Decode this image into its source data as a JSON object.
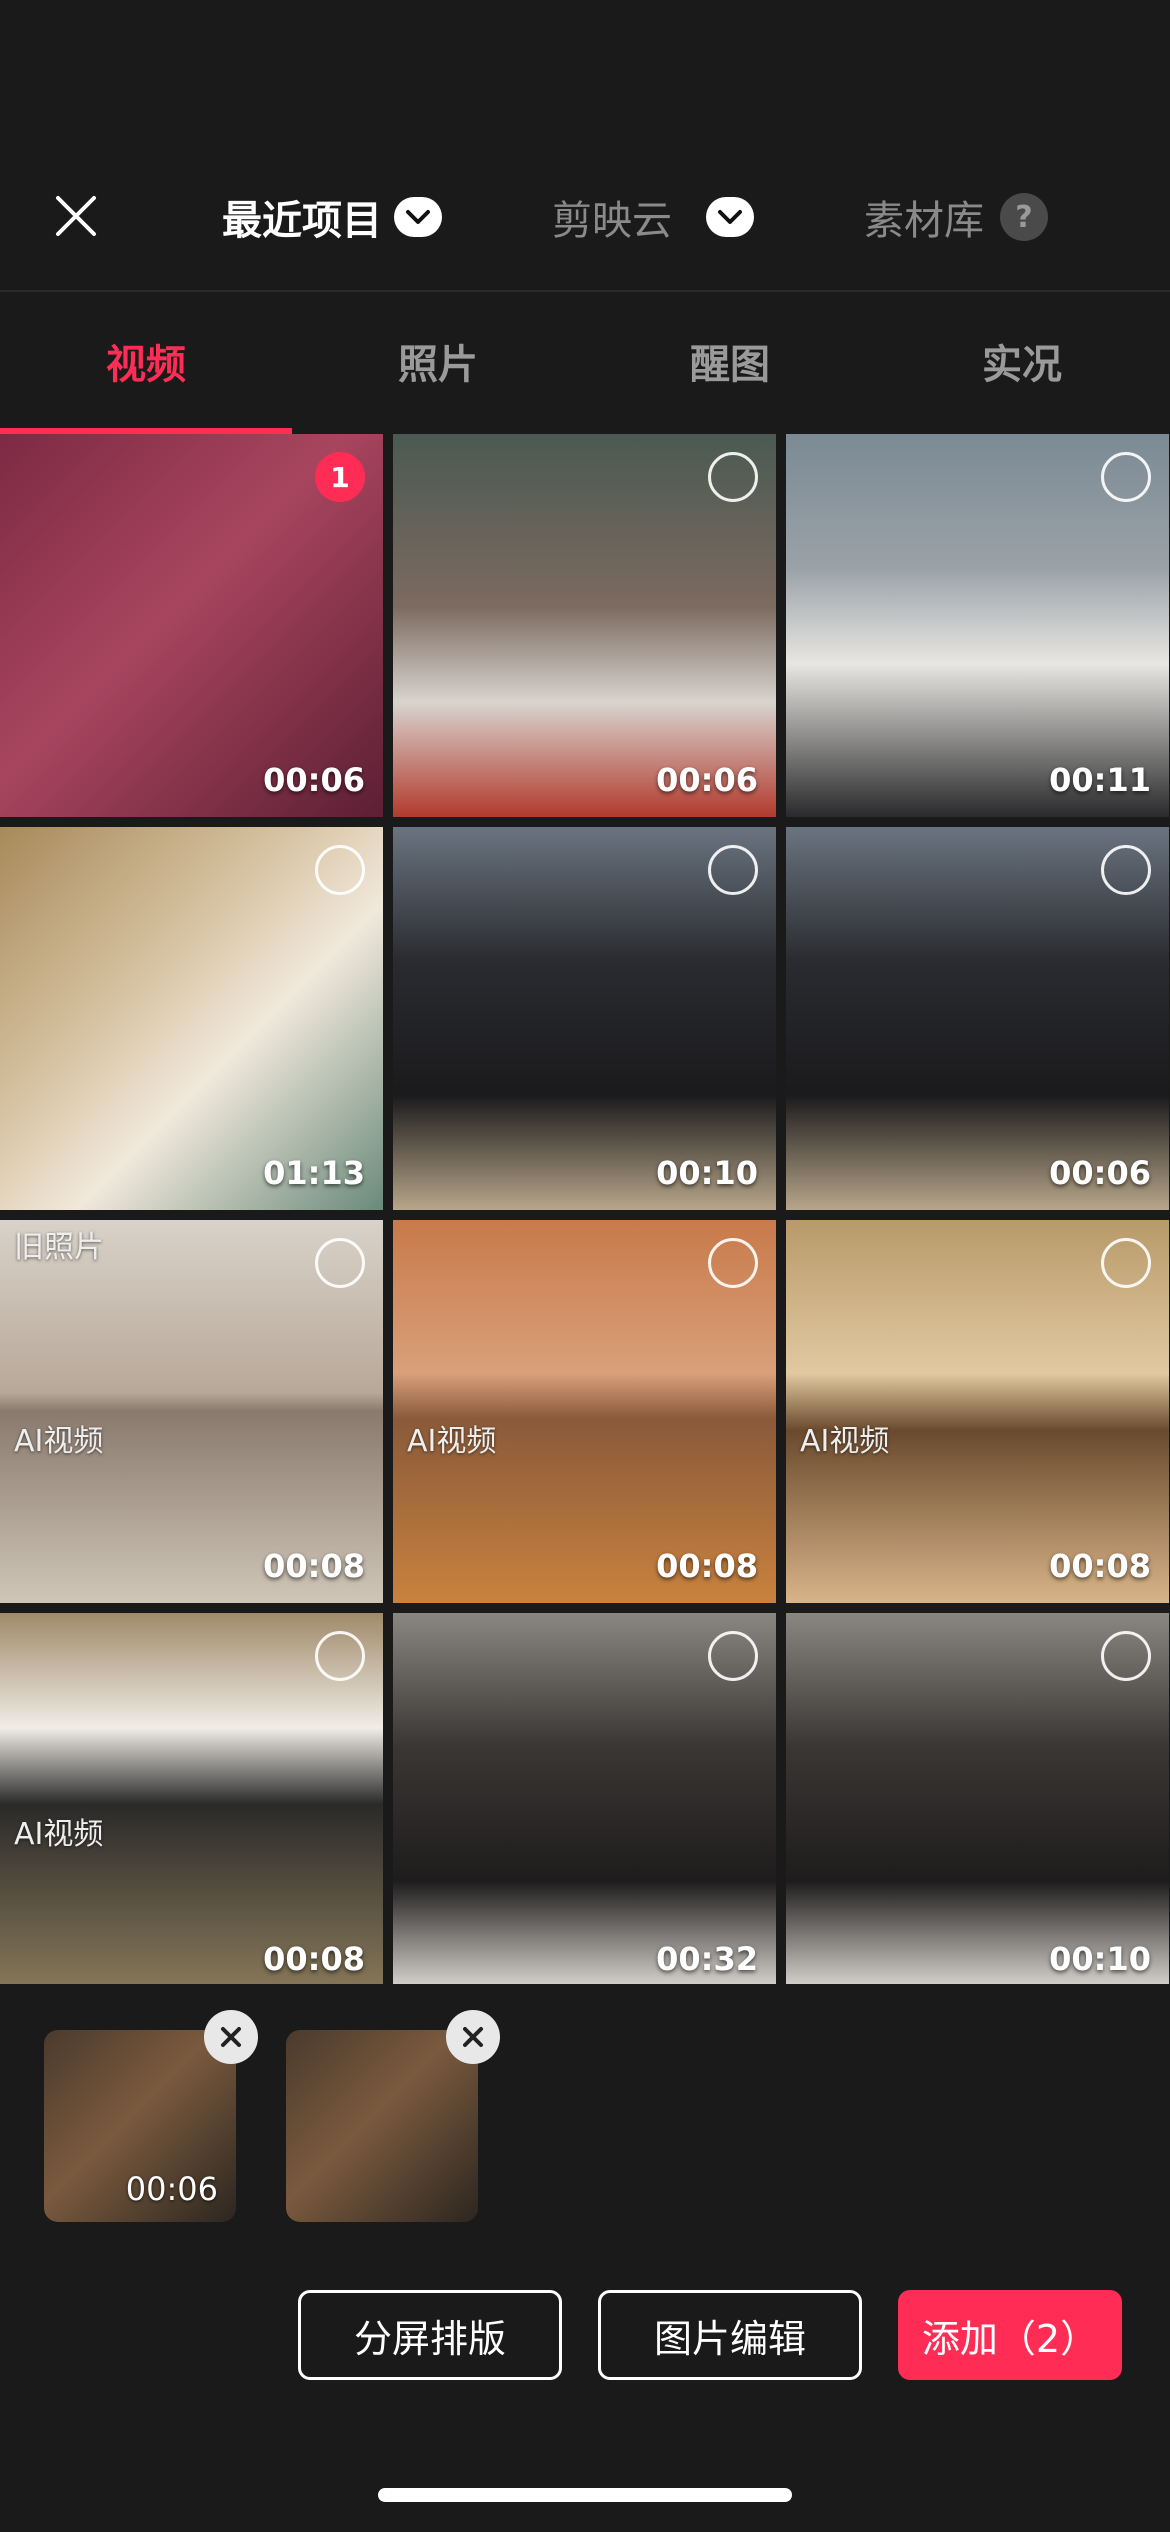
{
  "header": {
    "sources": [
      {
        "label": "最近项目",
        "active": true,
        "has_dropdown": true
      },
      {
        "label": "剪映云",
        "active": false,
        "has_dropdown": true
      },
      {
        "label": "素材库",
        "active": false,
        "has_help": true
      }
    ],
    "help_symbol": "?"
  },
  "media_tabs": [
    {
      "label": "视频",
      "active": true
    },
    {
      "label": "照片",
      "active": false
    },
    {
      "label": "醒图",
      "active": false
    },
    {
      "label": "实况",
      "active": false
    }
  ],
  "grid": [
    {
      "duration": "00:06",
      "selected_index": "1"
    },
    {
      "duration": "00:06",
      "selected_index": null
    },
    {
      "duration": "00:11",
      "selected_index": null
    },
    {
      "duration": "01:13",
      "selected_index": null
    },
    {
      "duration": "00:10",
      "selected_index": null
    },
    {
      "duration": "00:06",
      "selected_index": null
    },
    {
      "duration": "00:08",
      "selected_index": null,
      "captions": [
        "旧照片",
        "AI视频"
      ]
    },
    {
      "duration": "00:08",
      "selected_index": null,
      "captions": [
        "AI视频"
      ]
    },
    {
      "duration": "00:08",
      "selected_index": null,
      "captions": [
        "AI视频"
      ]
    },
    {
      "duration": "00:08",
      "selected_index": null,
      "captions": [
        "AI视频"
      ]
    },
    {
      "duration": "00:32",
      "selected_index": null
    },
    {
      "duration": "00:10",
      "selected_index": null
    }
  ],
  "tray": {
    "items": [
      {
        "duration": "00:06"
      },
      {
        "duration": ""
      }
    ]
  },
  "actions": {
    "split_layout": "分屏排版",
    "image_edit": "图片编辑",
    "add": "添加（2）"
  },
  "colors": {
    "accent": "#ff2d55",
    "background": "#1a1a1a",
    "inactive_text": "#9a9a9a"
  }
}
